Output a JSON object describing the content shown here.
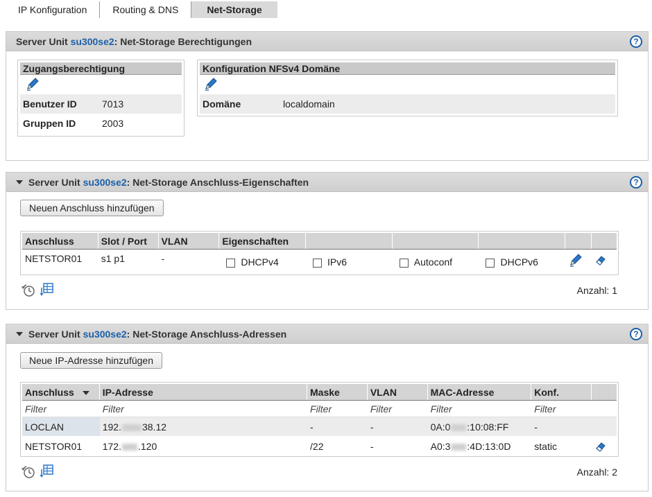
{
  "tabs": [
    {
      "label": "IP Konfiguration",
      "active": false
    },
    {
      "label": "Routing & DNS",
      "active": false
    },
    {
      "label": "Net-Storage",
      "active": true
    }
  ],
  "panel1": {
    "prefix": "Server Unit",
    "unit": "su300se2",
    "title": ": Net-Storage Berechtigungen",
    "access": {
      "title": "Zugangsberechtigung",
      "rows": [
        {
          "key": "Benutzer ID",
          "value": "7013"
        },
        {
          "key": "Gruppen ID",
          "value": "2003"
        }
      ]
    },
    "nfs": {
      "title": "Konfiguration NFSv4 Domäne",
      "rows": [
        {
          "key": "Domäne",
          "value": "localdomain"
        }
      ]
    }
  },
  "panel2": {
    "prefix": "Server Unit",
    "unit": "su300se2",
    "title": ": Net-Storage Anschluss-Eigenschaften",
    "add_button": "Neuen Anschluss hinzufügen",
    "columns": [
      "Anschluss",
      "Slot / Port",
      "VLAN",
      "Eigenschaften"
    ],
    "rows": [
      {
        "anschluss": "NETSTOR01",
        "slot": "s1 p1",
        "vlan": "-",
        "props": [
          "DHCPv4",
          "IPv6",
          "Autoconf",
          "DHCPv6"
        ]
      }
    ],
    "count": "Anzahl: 1"
  },
  "panel3": {
    "prefix": "Server Unit",
    "unit": "su300se2",
    "title": ": Net-Storage Anschluss-Adressen",
    "add_button": "Neue IP-Adresse hinzufügen",
    "columns": [
      "Anschluss",
      "IP-Adresse",
      "Maske",
      "VLAN",
      "MAC-Adresse",
      "Konf."
    ],
    "filter_label": "Filter",
    "rows": [
      {
        "anschluss": "LOCLAN",
        "ip_a": "192.",
        "ip_b": "38.12",
        "mask": "-",
        "vlan": "-",
        "mac_a": "0A:0",
        "mac_b": ":10:08:FF",
        "konf": "-"
      },
      {
        "anschluss": "NETSTOR01",
        "ip_a": "172.",
        "ip_b": ".120",
        "mask": "/22",
        "vlan": "-",
        "mac_a": "A0:3",
        "mac_b": ":4D:13:0D",
        "konf": "static"
      }
    ],
    "count": "Anzahl: 2"
  }
}
